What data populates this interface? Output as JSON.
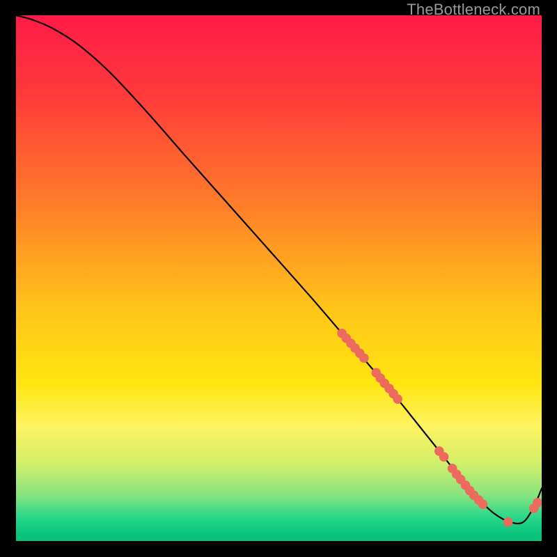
{
  "watermark": "TheBottleneck.com",
  "chart_data": {
    "type": "line",
    "title": "",
    "xlabel": "",
    "ylabel": "",
    "xlim": [
      0,
      100
    ],
    "ylim": [
      0,
      100
    ],
    "gradient_stops": [
      {
        "offset": 0.0,
        "color": "#ff1a48"
      },
      {
        "offset": 0.15,
        "color": "#ff3a3a"
      },
      {
        "offset": 0.35,
        "color": "#ff7a2a"
      },
      {
        "offset": 0.55,
        "color": "#ffc21a"
      },
      {
        "offset": 0.7,
        "color": "#ffe610"
      },
      {
        "offset": 0.78,
        "color": "#fef260"
      },
      {
        "offset": 0.85,
        "color": "#d4f06a"
      },
      {
        "offset": 0.91,
        "color": "#8ce47e"
      },
      {
        "offset": 0.955,
        "color": "#28d88a"
      },
      {
        "offset": 0.99,
        "color": "#06c27b"
      }
    ],
    "series": [
      {
        "name": "curve",
        "x": [
          0,
          3,
          7,
          12,
          18,
          25,
          32,
          40,
          48,
          56,
          62,
          68,
          73,
          77,
          81,
          84.5,
          88,
          91,
          94,
          96.5,
          98.5,
          100
        ],
        "y": [
          100,
          99.2,
          97.5,
          94.3,
          89.0,
          81.5,
          73.5,
          64.5,
          55.5,
          46.5,
          39.5,
          32.5,
          26.5,
          21.5,
          16.5,
          12.0,
          8.0,
          5.2,
          3.6,
          3.6,
          6.5,
          10.0
        ]
      }
    ],
    "dot_clusters": [
      {
        "x": 62.0,
        "y": 39.5
      },
      {
        "x": 62.8,
        "y": 38.6
      },
      {
        "x": 63.7,
        "y": 37.6
      },
      {
        "x": 64.5,
        "y": 36.7
      },
      {
        "x": 65.4,
        "y": 35.7
      },
      {
        "x": 66.2,
        "y": 34.8
      },
      {
        "x": 68.5,
        "y": 32.0
      },
      {
        "x": 69.3,
        "y": 31.0
      },
      {
        "x": 70.1,
        "y": 30.0
      },
      {
        "x": 71.0,
        "y": 29.0
      },
      {
        "x": 71.8,
        "y": 28.0
      },
      {
        "x": 72.6,
        "y": 27.0
      },
      {
        "x": 80.5,
        "y": 17.1
      },
      {
        "x": 81.4,
        "y": 16.0
      },
      {
        "x": 83.0,
        "y": 13.8
      },
      {
        "x": 83.8,
        "y": 12.7
      },
      {
        "x": 84.6,
        "y": 11.7
      },
      {
        "x": 85.5,
        "y": 10.6
      },
      {
        "x": 86.3,
        "y": 9.6
      },
      {
        "x": 87.1,
        "y": 8.7
      },
      {
        "x": 88.0,
        "y": 7.8
      },
      {
        "x": 88.8,
        "y": 7.0
      },
      {
        "x": 93.6,
        "y": 3.6
      },
      {
        "x": 98.5,
        "y": 6.2
      },
      {
        "x": 99.2,
        "y": 7.3
      }
    ],
    "dot_radius": 6.8,
    "dot_color": "#ec6a5e",
    "line_color": "#000000",
    "line_width": 2.2
  }
}
